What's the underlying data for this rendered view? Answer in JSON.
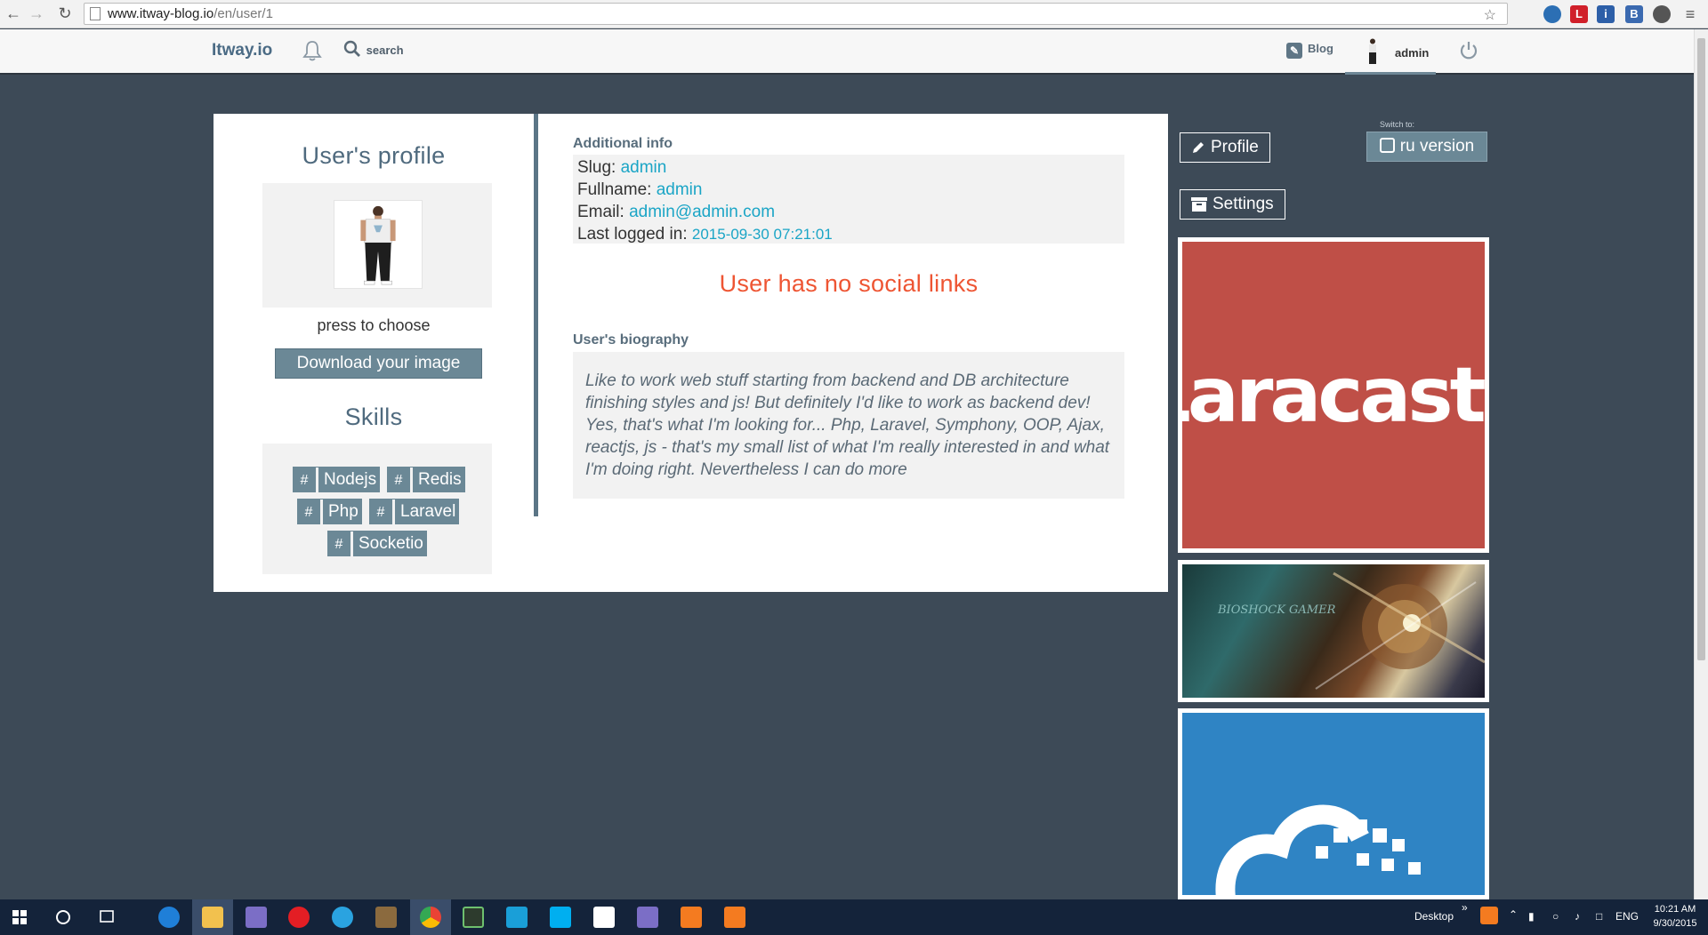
{
  "browser": {
    "url_host": "www.itway-blog.io",
    "url_path": "/en/user/1"
  },
  "header": {
    "brand": "Itway.io",
    "search_label": "search",
    "blog_label": "Blog",
    "user_label": "admin"
  },
  "profile": {
    "title": "User's profile",
    "press_label": "press to choose",
    "download_label": "Download your image",
    "skills_title": "Skills",
    "skills": [
      "Nodejs",
      "Redis",
      "Php",
      "Laravel",
      "Socketio"
    ],
    "skill_hash": "#"
  },
  "info": {
    "section_label": "Additional info",
    "slug_label": "Slug:",
    "slug": "admin",
    "fullname_label": "Fullname:",
    "fullname": "admin",
    "email_label": "Email:",
    "email": "admin@admin.com",
    "last_login_label": "Last logged in:",
    "last_login": "2015-09-30 07:21:01",
    "no_social": "User has no social links",
    "bio_label": "User's biography",
    "bio": "Like to work web stuff starting from backend and DB architecture finishing styles and js! But definitely I'd like to work as backend dev! Yes, that's what I'm looking for... Php, Laravel, Symphony, OOP, Ajax, reactjs, js - that's my small list of what I'm really interested in and what I'm doing right. Nevertheless I can do more"
  },
  "side": {
    "profile_btn": "Profile",
    "settings_btn": "Settings",
    "switch_label": "Switch to:",
    "ru_btn": "ru version",
    "ad1_text": "Laracasts",
    "ad2_text": "BIOSHOCK GAMER"
  },
  "taskbar": {
    "desktop_label": "Desktop",
    "lang": "ENG",
    "time": "10:21 AM",
    "date": "9/30/2015"
  },
  "colors": {
    "page_bg": "#3d4a57",
    "accent": "#6b8896",
    "link": "#1ba5c6",
    "alert": "#ee5533"
  }
}
